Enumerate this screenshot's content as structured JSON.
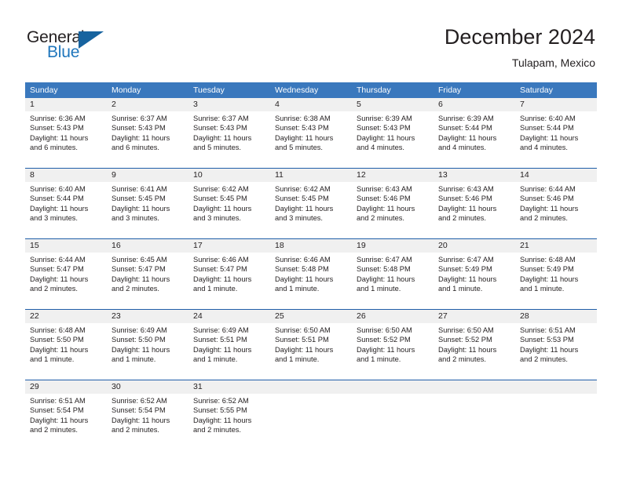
{
  "brand": {
    "name_top": "General",
    "name_bottom": "Blue",
    "triangle_icon": "blue-triangle-icon",
    "color_dark": "#231f20",
    "color_blue": "#1f76bc"
  },
  "header": {
    "title": "December 2024",
    "subtitle": "Tulapam, Mexico"
  },
  "theme": {
    "header_band": "#3a78bd",
    "week_rule": "#1f5ea8",
    "daynum_band": "#f0f0f0",
    "text": "#231f20"
  },
  "weekdays": [
    "Sunday",
    "Monday",
    "Tuesday",
    "Wednesday",
    "Thursday",
    "Friday",
    "Saturday"
  ],
  "weeks": [
    {
      "days": [
        {
          "num": "1",
          "sunrise": "Sunrise: 6:36 AM",
          "sunset": "Sunset: 5:43 PM",
          "daylight_1": "Daylight: 11 hours",
          "daylight_2": "and 6 minutes."
        },
        {
          "num": "2",
          "sunrise": "Sunrise: 6:37 AM",
          "sunset": "Sunset: 5:43 PM",
          "daylight_1": "Daylight: 11 hours",
          "daylight_2": "and 6 minutes."
        },
        {
          "num": "3",
          "sunrise": "Sunrise: 6:37 AM",
          "sunset": "Sunset: 5:43 PM",
          "daylight_1": "Daylight: 11 hours",
          "daylight_2": "and 5 minutes."
        },
        {
          "num": "4",
          "sunrise": "Sunrise: 6:38 AM",
          "sunset": "Sunset: 5:43 PM",
          "daylight_1": "Daylight: 11 hours",
          "daylight_2": "and 5 minutes."
        },
        {
          "num": "5",
          "sunrise": "Sunrise: 6:39 AM",
          "sunset": "Sunset: 5:43 PM",
          "daylight_1": "Daylight: 11 hours",
          "daylight_2": "and 4 minutes."
        },
        {
          "num": "6",
          "sunrise": "Sunrise: 6:39 AM",
          "sunset": "Sunset: 5:44 PM",
          "daylight_1": "Daylight: 11 hours",
          "daylight_2": "and 4 minutes."
        },
        {
          "num": "7",
          "sunrise": "Sunrise: 6:40 AM",
          "sunset": "Sunset: 5:44 PM",
          "daylight_1": "Daylight: 11 hours",
          "daylight_2": "and 4 minutes."
        }
      ]
    },
    {
      "days": [
        {
          "num": "8",
          "sunrise": "Sunrise: 6:40 AM",
          "sunset": "Sunset: 5:44 PM",
          "daylight_1": "Daylight: 11 hours",
          "daylight_2": "and 3 minutes."
        },
        {
          "num": "9",
          "sunrise": "Sunrise: 6:41 AM",
          "sunset": "Sunset: 5:45 PM",
          "daylight_1": "Daylight: 11 hours",
          "daylight_2": "and 3 minutes."
        },
        {
          "num": "10",
          "sunrise": "Sunrise: 6:42 AM",
          "sunset": "Sunset: 5:45 PM",
          "daylight_1": "Daylight: 11 hours",
          "daylight_2": "and 3 minutes."
        },
        {
          "num": "11",
          "sunrise": "Sunrise: 6:42 AM",
          "sunset": "Sunset: 5:45 PM",
          "daylight_1": "Daylight: 11 hours",
          "daylight_2": "and 3 minutes."
        },
        {
          "num": "12",
          "sunrise": "Sunrise: 6:43 AM",
          "sunset": "Sunset: 5:46 PM",
          "daylight_1": "Daylight: 11 hours",
          "daylight_2": "and 2 minutes."
        },
        {
          "num": "13",
          "sunrise": "Sunrise: 6:43 AM",
          "sunset": "Sunset: 5:46 PM",
          "daylight_1": "Daylight: 11 hours",
          "daylight_2": "and 2 minutes."
        },
        {
          "num": "14",
          "sunrise": "Sunrise: 6:44 AM",
          "sunset": "Sunset: 5:46 PM",
          "daylight_1": "Daylight: 11 hours",
          "daylight_2": "and 2 minutes."
        }
      ]
    },
    {
      "days": [
        {
          "num": "15",
          "sunrise": "Sunrise: 6:44 AM",
          "sunset": "Sunset: 5:47 PM",
          "daylight_1": "Daylight: 11 hours",
          "daylight_2": "and 2 minutes."
        },
        {
          "num": "16",
          "sunrise": "Sunrise: 6:45 AM",
          "sunset": "Sunset: 5:47 PM",
          "daylight_1": "Daylight: 11 hours",
          "daylight_2": "and 2 minutes."
        },
        {
          "num": "17",
          "sunrise": "Sunrise: 6:46 AM",
          "sunset": "Sunset: 5:47 PM",
          "daylight_1": "Daylight: 11 hours",
          "daylight_2": "and 1 minute."
        },
        {
          "num": "18",
          "sunrise": "Sunrise: 6:46 AM",
          "sunset": "Sunset: 5:48 PM",
          "daylight_1": "Daylight: 11 hours",
          "daylight_2": "and 1 minute."
        },
        {
          "num": "19",
          "sunrise": "Sunrise: 6:47 AM",
          "sunset": "Sunset: 5:48 PM",
          "daylight_1": "Daylight: 11 hours",
          "daylight_2": "and 1 minute."
        },
        {
          "num": "20",
          "sunrise": "Sunrise: 6:47 AM",
          "sunset": "Sunset: 5:49 PM",
          "daylight_1": "Daylight: 11 hours",
          "daylight_2": "and 1 minute."
        },
        {
          "num": "21",
          "sunrise": "Sunrise: 6:48 AM",
          "sunset": "Sunset: 5:49 PM",
          "daylight_1": "Daylight: 11 hours",
          "daylight_2": "and 1 minute."
        }
      ]
    },
    {
      "days": [
        {
          "num": "22",
          "sunrise": "Sunrise: 6:48 AM",
          "sunset": "Sunset: 5:50 PM",
          "daylight_1": "Daylight: 11 hours",
          "daylight_2": "and 1 minute."
        },
        {
          "num": "23",
          "sunrise": "Sunrise: 6:49 AM",
          "sunset": "Sunset: 5:50 PM",
          "daylight_1": "Daylight: 11 hours",
          "daylight_2": "and 1 minute."
        },
        {
          "num": "24",
          "sunrise": "Sunrise: 6:49 AM",
          "sunset": "Sunset: 5:51 PM",
          "daylight_1": "Daylight: 11 hours",
          "daylight_2": "and 1 minute."
        },
        {
          "num": "25",
          "sunrise": "Sunrise: 6:50 AM",
          "sunset": "Sunset: 5:51 PM",
          "daylight_1": "Daylight: 11 hours",
          "daylight_2": "and 1 minute."
        },
        {
          "num": "26",
          "sunrise": "Sunrise: 6:50 AM",
          "sunset": "Sunset: 5:52 PM",
          "daylight_1": "Daylight: 11 hours",
          "daylight_2": "and 1 minute."
        },
        {
          "num": "27",
          "sunrise": "Sunrise: 6:50 AM",
          "sunset": "Sunset: 5:52 PM",
          "daylight_1": "Daylight: 11 hours",
          "daylight_2": "and 2 minutes."
        },
        {
          "num": "28",
          "sunrise": "Sunrise: 6:51 AM",
          "sunset": "Sunset: 5:53 PM",
          "daylight_1": "Daylight: 11 hours",
          "daylight_2": "and 2 minutes."
        }
      ]
    },
    {
      "days": [
        {
          "num": "29",
          "sunrise": "Sunrise: 6:51 AM",
          "sunset": "Sunset: 5:54 PM",
          "daylight_1": "Daylight: 11 hours",
          "daylight_2": "and 2 minutes."
        },
        {
          "num": "30",
          "sunrise": "Sunrise: 6:52 AM",
          "sunset": "Sunset: 5:54 PM",
          "daylight_1": "Daylight: 11 hours",
          "daylight_2": "and 2 minutes."
        },
        {
          "num": "31",
          "sunrise": "Sunrise: 6:52 AM",
          "sunset": "Sunset: 5:55 PM",
          "daylight_1": "Daylight: 11 hours",
          "daylight_2": "and 2 minutes."
        },
        {
          "num": "",
          "sunrise": "",
          "sunset": "",
          "daylight_1": "",
          "daylight_2": ""
        },
        {
          "num": "",
          "sunrise": "",
          "sunset": "",
          "daylight_1": "",
          "daylight_2": ""
        },
        {
          "num": "",
          "sunrise": "",
          "sunset": "",
          "daylight_1": "",
          "daylight_2": ""
        },
        {
          "num": "",
          "sunrise": "",
          "sunset": "",
          "daylight_1": "",
          "daylight_2": ""
        }
      ]
    }
  ]
}
